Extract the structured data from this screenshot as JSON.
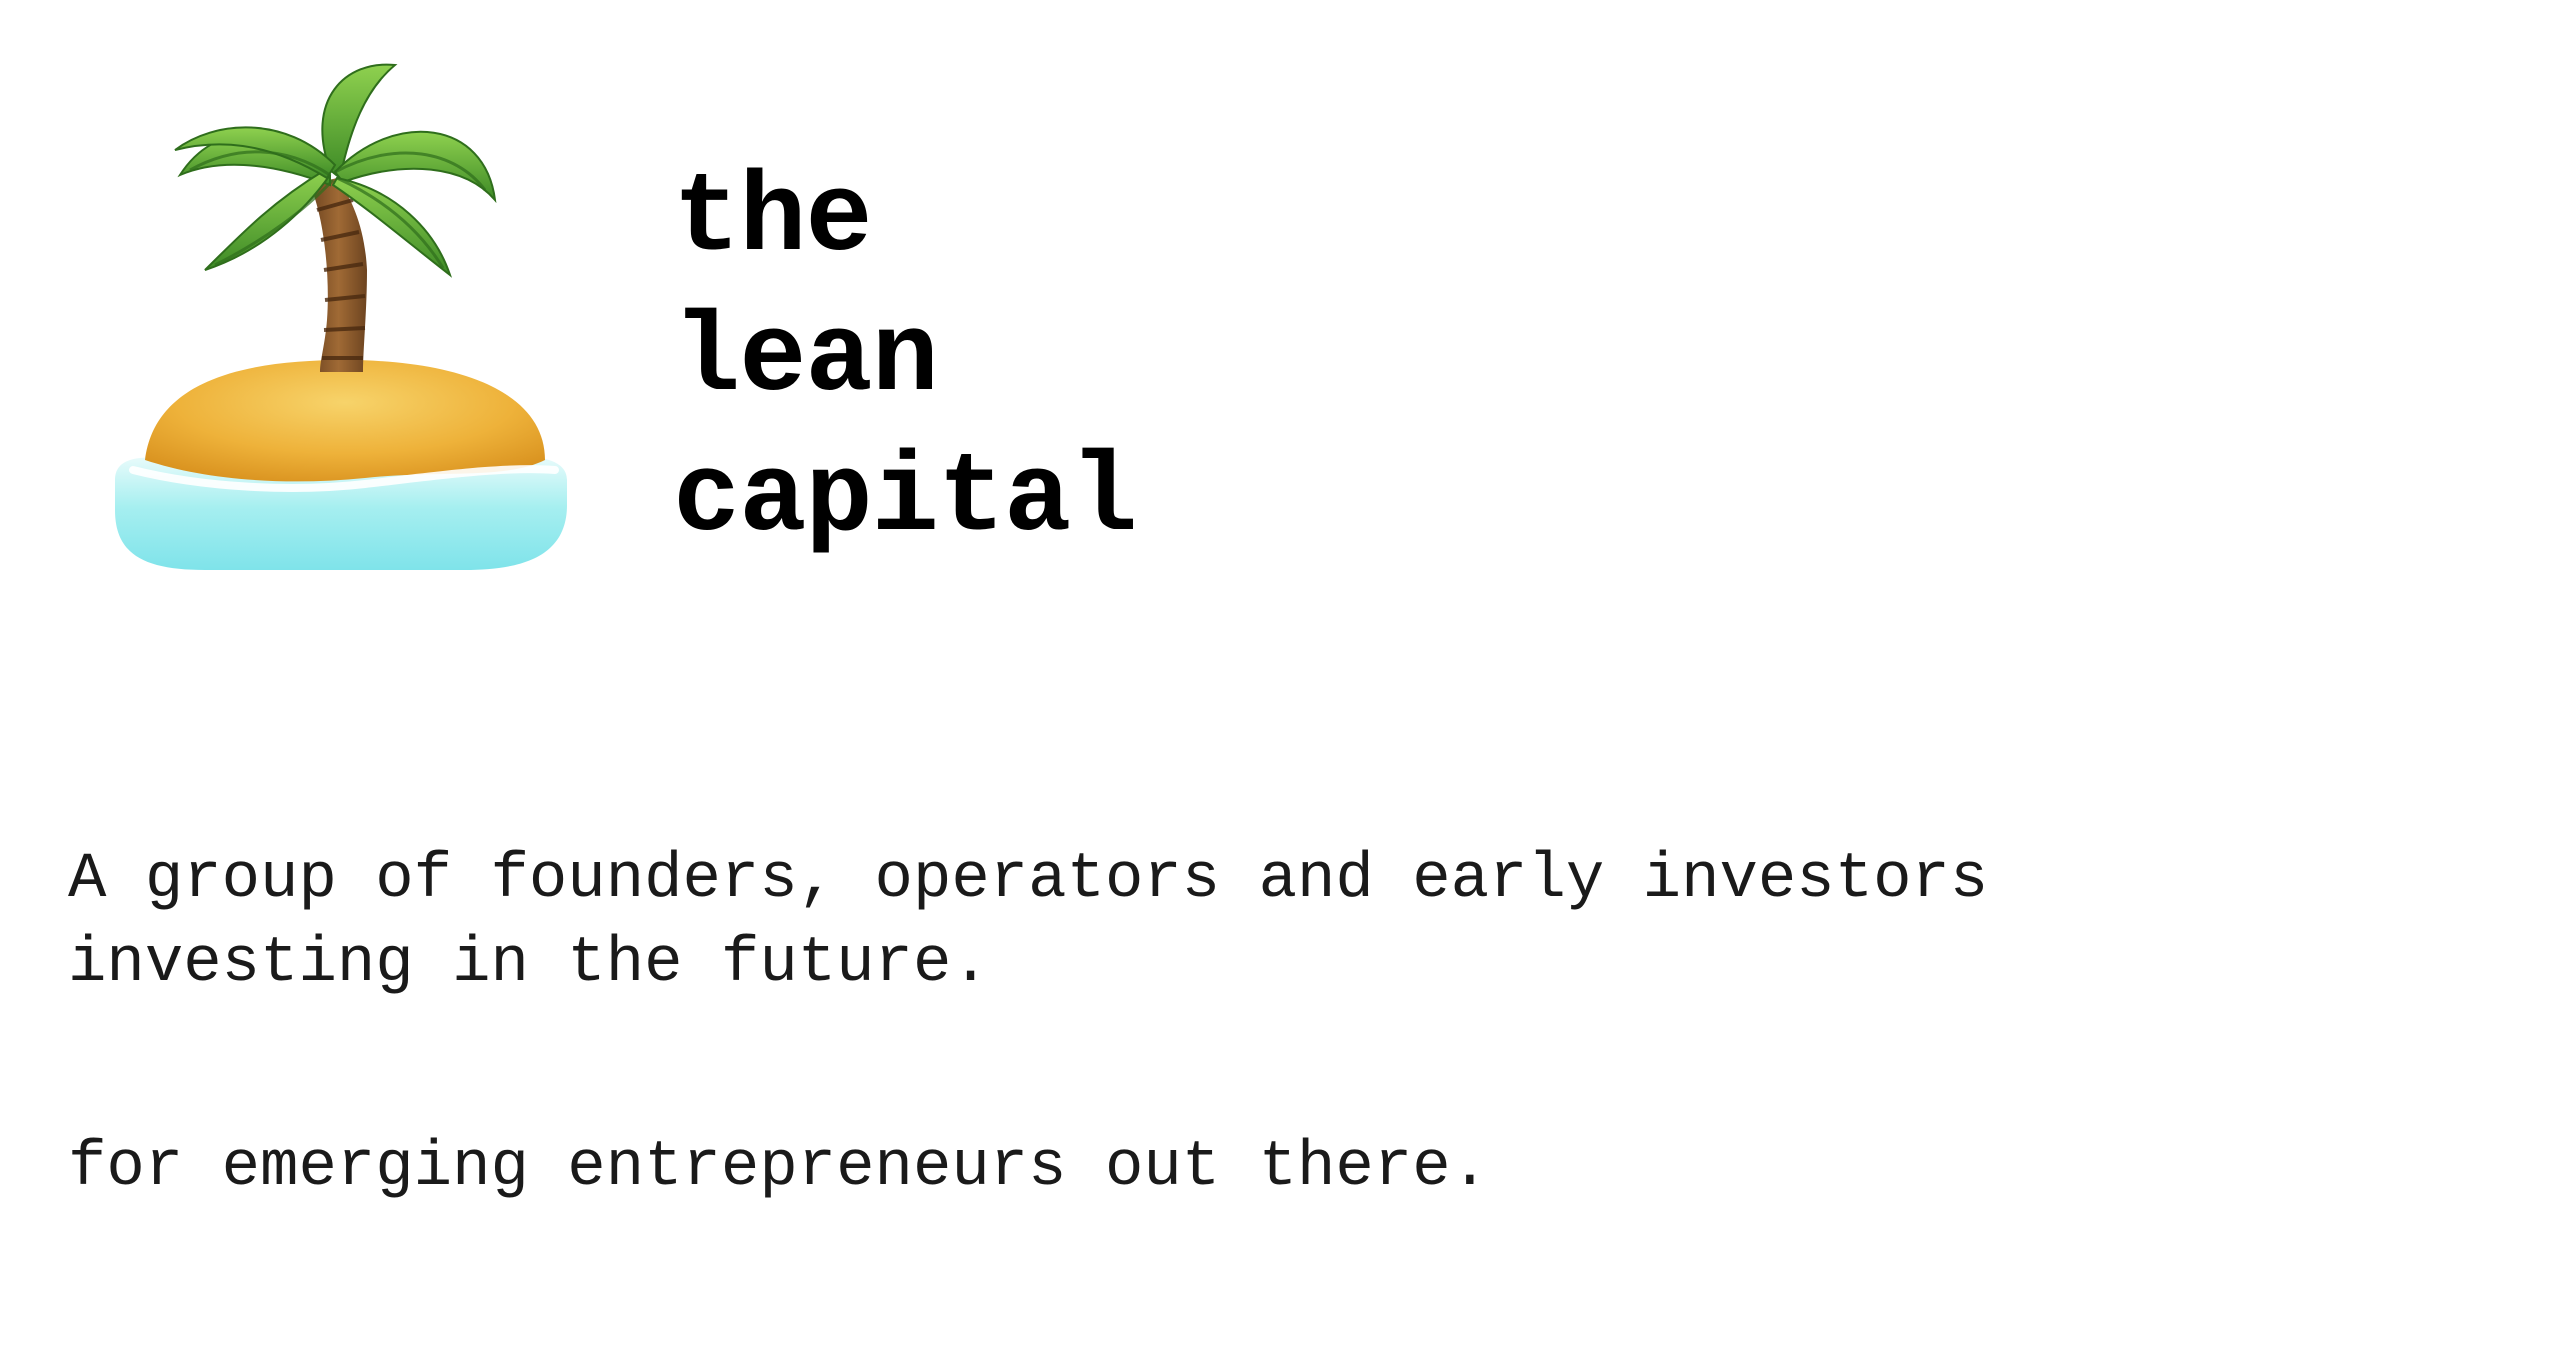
{
  "logo": {
    "icon": "desert-island-icon",
    "colors": {
      "leaves": "#5aa832",
      "trunk": "#8a5a2b",
      "sand": "#f0b43c",
      "water": "#8ee8ee"
    }
  },
  "brand": {
    "line1": "the",
    "line2": "lean",
    "line3": "capital"
  },
  "content": {
    "tagline": "A group of founders, operators and early investors\ninvesting in the future.",
    "subline": "for emerging entrepreneurs out there."
  }
}
